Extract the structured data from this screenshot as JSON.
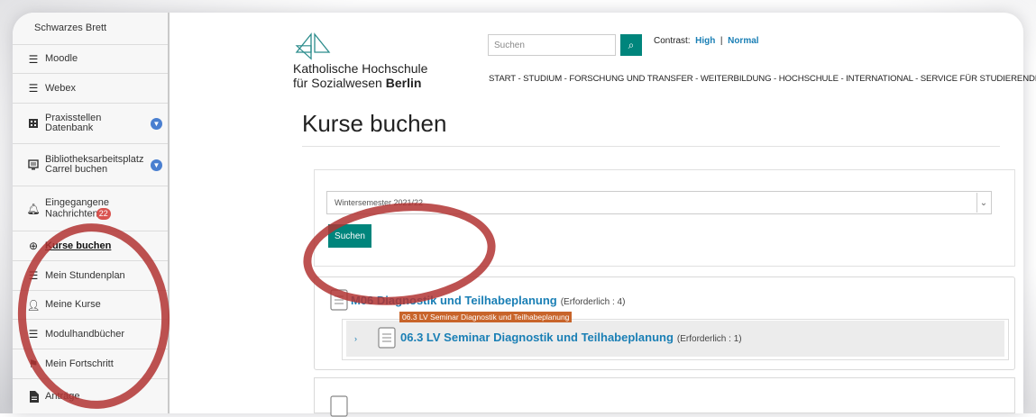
{
  "sidebar": {
    "items": [
      {
        "label": "Schwarzes Brett",
        "icon": "none"
      },
      {
        "label": "Moodle",
        "icon": "menu-icon"
      },
      {
        "label": "Webex",
        "icon": "menu-icon"
      },
      {
        "label": "Praxisstellen\nDatenbank",
        "icon": "building-icon",
        "chevron": true
      },
      {
        "label": "Bibliotheksarbeitsplatz\nCarrel buchen",
        "icon": "monitor-icon",
        "chevron": true
      },
      {
        "label": "Eingegangene\nNachrichten",
        "icon": "bell-icon",
        "badge": "22"
      },
      {
        "label": "Kurse buchen",
        "icon": "plus-circle-icon",
        "active": true
      },
      {
        "label": "Mein Stundenplan",
        "icon": "menu-icon"
      },
      {
        "label": "Meine Kurse",
        "icon": "user-icon"
      },
      {
        "label": "Modulhandbücher",
        "icon": "menu-icon"
      },
      {
        "label": "Mein Fortschritt",
        "icon": "flag-icon"
      },
      {
        "label": "Anträge",
        "icon": "file-icon"
      }
    ]
  },
  "header": {
    "logo_line1": "Katholische Hochschule",
    "logo_line2_prefix": "für Sozialwesen ",
    "logo_line2_bold": "Berlin",
    "search_placeholder": "Suchen",
    "contrast_label": "Contrast:",
    "contrast_high": "High",
    "contrast_sep": "|",
    "contrast_normal": "Normal",
    "nav": "START  - STUDIUM  - FORSCHUNG UND TRANSFER  - WEITERBILDUNG  - HOCHSCHULE  - INTERNATIONAL  - SERVICE FÜR STUDIERENDE"
  },
  "page": {
    "title": "Kurse buchen"
  },
  "form": {
    "semester_value": "Wintersemester 2021/22",
    "submit_label": "Suchen"
  },
  "courses": [
    {
      "title": "M06 Diagnostik und Teilhabeplanung",
      "required": "(Erforderlich : 4)",
      "tooltip": "06.3 LV Seminar Diagnostik und Teilhabeplanung",
      "sub_title": "06.3 LV Seminar Diagnostik und Teilhabeplanung",
      "sub_required": "(Erforderlich : 1)"
    }
  ],
  "colors": {
    "accent": "#00857c",
    "link": "#1a7fb5",
    "annotation": "#b23432"
  }
}
